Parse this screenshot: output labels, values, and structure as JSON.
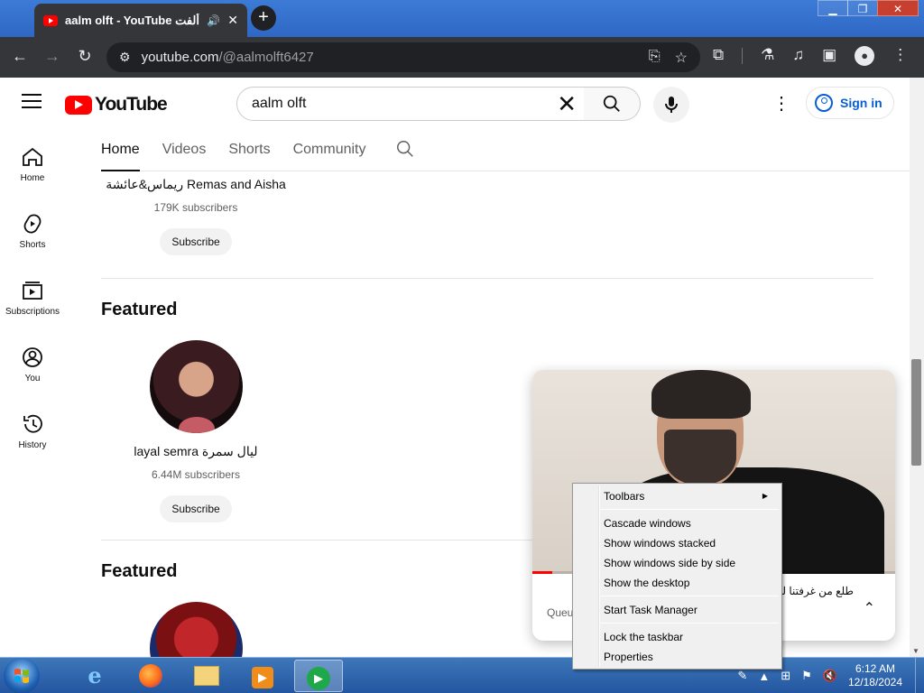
{
  "browser": {
    "tab_title": "aalm olft - YouTube عالم ألفت",
    "tab_audio_icon": "speaker-icon",
    "url_host": "youtube.com",
    "url_path": "/@aalmolft6427"
  },
  "youtube": {
    "logo_text": "YouTube",
    "search_value": "aalm olft",
    "sign_in": "Sign in",
    "guide": [
      {
        "label": "Home",
        "icon": "home-icon"
      },
      {
        "label": "Shorts",
        "icon": "shorts-icon"
      },
      {
        "label": "Subscriptions",
        "icon": "subscriptions-icon"
      },
      {
        "label": "You",
        "icon": "you-icon"
      },
      {
        "label": "History",
        "icon": "history-icon"
      }
    ],
    "tabs": [
      "Home",
      "Videos",
      "Shorts",
      "Community"
    ],
    "active_tab": "Home",
    "channels": [
      {
        "name": "ريماس&عائشة Remas and Aisha",
        "subs": "179K subscribers",
        "subscribe": "Subscribe"
      },
      {
        "name": "layal semra ليال سمرة",
        "subs": "6.44M subscribers",
        "subscribe": "Subscribe"
      }
    ],
    "shelves": [
      "Featured",
      "Featured"
    ]
  },
  "miniplayer": {
    "title": "طلع من غرفتنا ليه؟ ... ووالفت",
    "queue": "Queu",
    "progress": 0.055
  },
  "context_menu": {
    "toolbars": "Toolbars",
    "cascade": "Cascade windows",
    "stacked": "Show windows stacked",
    "side_by_side": "Show windows side by side",
    "desktop": "Show the desktop",
    "task_manager": "Start Task Manager",
    "lock": "Lock the taskbar",
    "properties": "Properties"
  },
  "taskbar": {
    "apps": [
      "internet-explorer-icon",
      "firefox-icon",
      "file-explorer-icon",
      "media-player-icon",
      "active-app-icon"
    ],
    "time": "6:12 AM",
    "date": "12/18/2024"
  },
  "colors": {
    "youtube_red": "#ff0000",
    "link_blue": "#065fd4",
    "chrome_dark": "#35363a"
  }
}
